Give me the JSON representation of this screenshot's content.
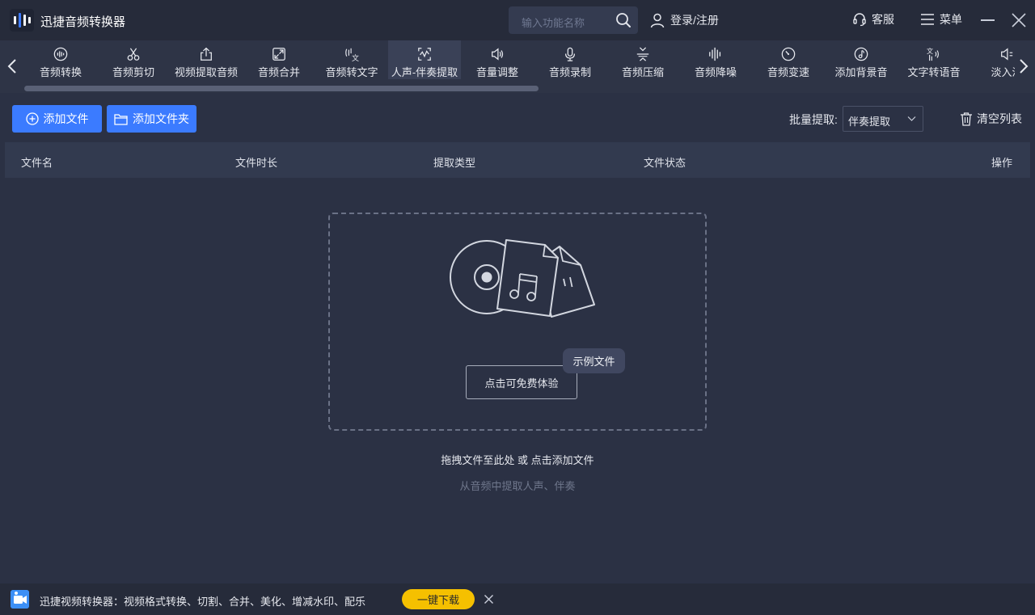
{
  "app": {
    "title": "迅捷音频转换器"
  },
  "search": {
    "placeholder": "输入功能名称"
  },
  "header": {
    "login": "登录/注册",
    "service": "客服",
    "menu": "菜单"
  },
  "tabs": [
    {
      "label": "音频转换",
      "icon": "audio-convert-icon"
    },
    {
      "label": "音频剪切",
      "icon": "scissors-icon"
    },
    {
      "label": "视频提取音频",
      "icon": "share-upload-icon"
    },
    {
      "label": "音频合并",
      "icon": "merge-icon"
    },
    {
      "label": "音频转文字",
      "icon": "audio-text-icon"
    },
    {
      "label": "人声-伴奏提取",
      "icon": "vocal-extract-icon",
      "active": true
    },
    {
      "label": "音量调整",
      "icon": "volume-icon"
    },
    {
      "label": "音频录制",
      "icon": "microphone-icon"
    },
    {
      "label": "音频压缩",
      "icon": "compress-icon"
    },
    {
      "label": "音频降噪",
      "icon": "noise-reduce-icon"
    },
    {
      "label": "音频变速",
      "icon": "speed-dial-icon"
    },
    {
      "label": "添加背景音",
      "icon": "music-note-icon"
    },
    {
      "label": "文字转语音",
      "icon": "text-speech-icon"
    },
    {
      "label": "淡入淡",
      "icon": "fade-icon"
    }
  ],
  "toolbar": {
    "add_file": "添加文件",
    "add_folder": "添加文件夹",
    "batch_label": "批量提取:",
    "batch_value": "伴奏提取",
    "clear_list": "清空列表"
  },
  "table": {
    "columns": [
      "文件名",
      "文件时长",
      "提取类型",
      "文件状态",
      "操作"
    ]
  },
  "dropzone": {
    "try_button": "点击可免费体验",
    "sample_tag": "示例文件",
    "hint_primary": "拖拽文件至此处 或 点击添加文件",
    "hint_secondary": "从音频中提取人声、伴奏"
  },
  "adbar": {
    "text": "迅捷视频转换器：视频格式转换、切割、合并、美化、增减水印、配乐",
    "download": "一键下载"
  },
  "colors": {
    "accent": "#3b7bff",
    "download_button": "#f5c000",
    "background": "#2b3144"
  }
}
